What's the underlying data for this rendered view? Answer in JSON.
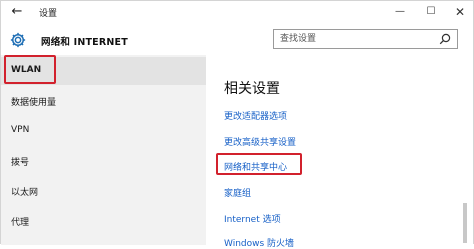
{
  "window": {
    "title": "设置",
    "back_glyph": "←",
    "minimize_glyph": "—",
    "maximize_glyph": "☐",
    "close_glyph": "✕"
  },
  "header": {
    "section_title": "网络和 INTERNET",
    "search_placeholder": "查找设置"
  },
  "sidebar": {
    "items": [
      {
        "label": "WLAN",
        "selected": true
      },
      {
        "label": "数据使用量"
      },
      {
        "label": "VPN"
      },
      {
        "label": "拨号"
      },
      {
        "label": "以太网"
      },
      {
        "label": "代理"
      }
    ]
  },
  "main": {
    "heading": "相关设置",
    "links": [
      "更改适配器选项",
      "更改高级共享设置",
      "网络和共享中心",
      "家庭组",
      "Internet 选项",
      "Windows 防火墙"
    ]
  },
  "colors": {
    "link": "#1760c7",
    "annotation_red": "#d2212d",
    "sidebar_bg": "#f2f2f2"
  }
}
